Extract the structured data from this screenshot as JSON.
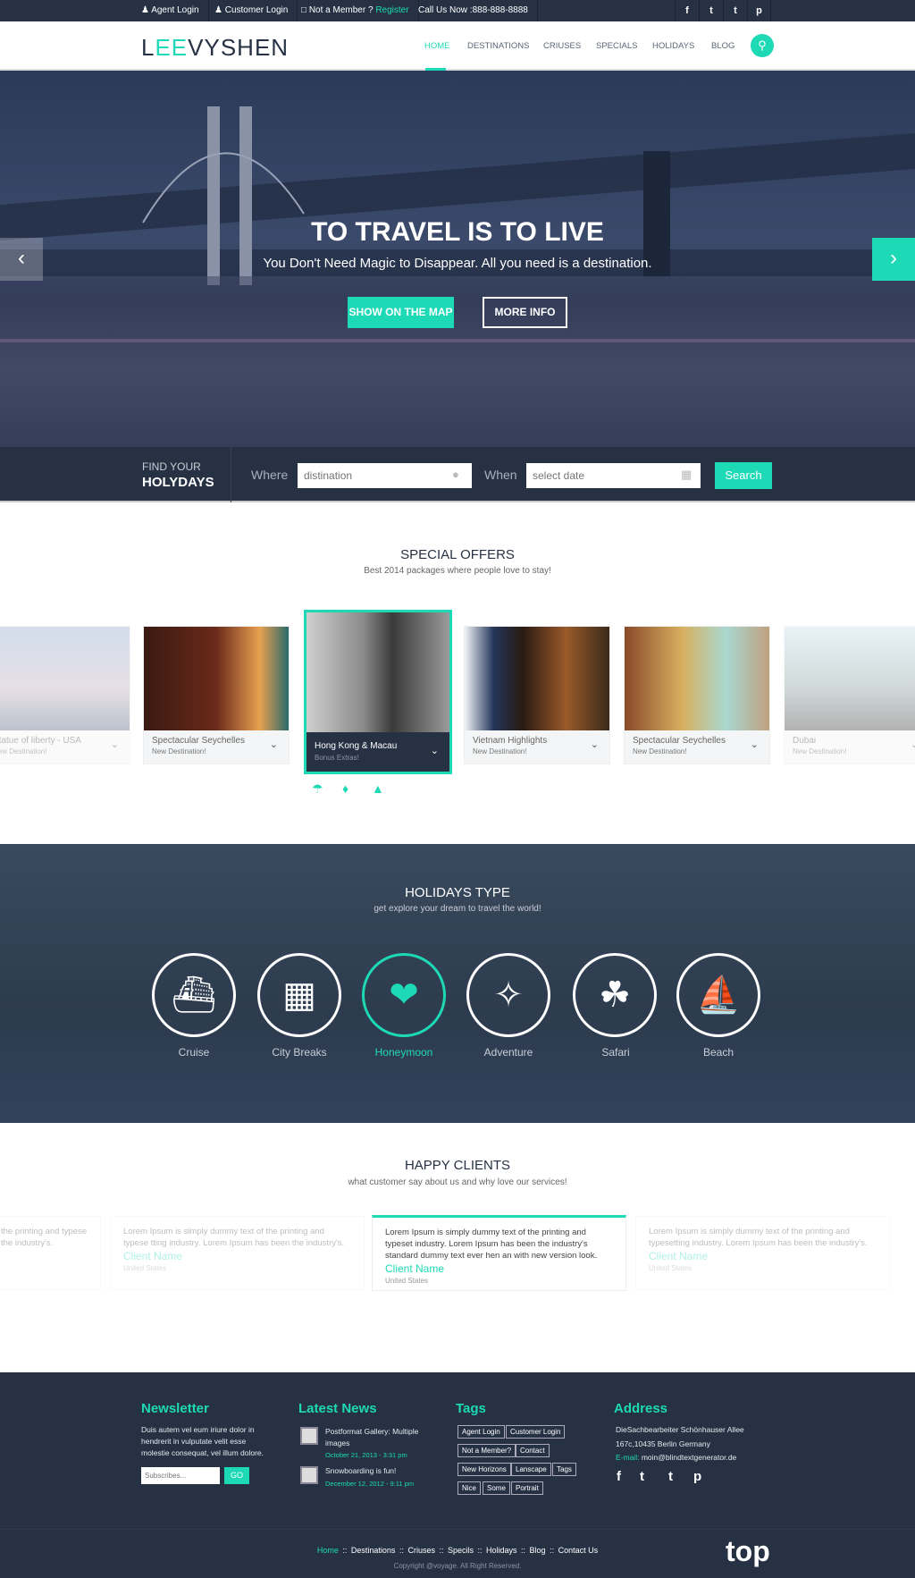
{
  "topbar": {
    "agent_login": "Agent Login",
    "customer_login": "Customer Login",
    "not_member": "Not a Member ?",
    "register": "Register",
    "call": "Call Us Now :888-888-8888",
    "social": [
      "f",
      "t",
      "t",
      "p"
    ]
  },
  "header": {
    "logo_a": "L",
    "logo_b": "EE",
    "logo_c": "VYSHEN",
    "nav": [
      "HOME",
      "DESTINATIONS",
      "CRIUSES",
      "SPECIALS",
      "HOLIDAYS",
      "BLOG"
    ]
  },
  "hero": {
    "title": "TO TRAVEL IS TO LIVE",
    "subtitle": "You Don't Need Magic to Disappear. All you need is a destination.",
    "show_map": "SHOW ON THE MAP",
    "more_info": "MORE INFO"
  },
  "search": {
    "find_your": "FIND YOUR",
    "holydays": "HOLYDAYS",
    "where": "Where",
    "where_placeholder": "distination",
    "when": "When",
    "when_placeholder": "select date",
    "button": "Search"
  },
  "offers": {
    "title": "SPECIAL OFFERS",
    "subtitle": "Best 2014 packages where people love to stay!",
    "cards": [
      {
        "title": "Statue of liberty - USA",
        "sub": "New Destination!"
      },
      {
        "title": "Spectacular Seychelles",
        "sub": "New Destination!"
      },
      {
        "title": "Hong Kong & Macau",
        "sub": "Bonus Extras!"
      },
      {
        "title": "Vietnam Highlights",
        "sub": "New Destination!"
      },
      {
        "title": "Spectacular Seychelles",
        "sub": "New Destination!"
      },
      {
        "title": "Dubai",
        "sub": "New Destination!"
      }
    ]
  },
  "holidays": {
    "title": "HOLIDAYS TYPE",
    "subtitle": "get explore your dream to travel the world!",
    "types": [
      "Cruise",
      "City Breaks",
      "Honeymoon",
      "Adventure",
      "Safari",
      "Beach"
    ]
  },
  "clients": {
    "title": "HAPPY CLIENTS",
    "subtitle": "what customer say about us and why love our services!",
    "cards": [
      {
        "text": "the printing and typese the industry's."
      },
      {
        "text": "Lorem Ipsum is simply dummy text of the printing and typese tting industry. Lorem Ipsum has been the industry's.",
        "name": "Client Name",
        "country": "United States"
      },
      {
        "text": "Lorem Ipsum is simply dummy text of the printing and typeset industry. Lorem Ipsum has been the industry's standard dummy text ever hen an with new version look.",
        "name": "Client Name",
        "country": "United States"
      },
      {
        "text": "Lorem Ipsum is simply dummy text of the printing and typesetting industry. Lorem Ipsum has been the industry's.",
        "name": "Client Name",
        "country": "United States"
      }
    ]
  },
  "footer": {
    "newsletter": {
      "title": "Newsletter",
      "text": "Duis autem vel eum iriure dolor in hendrerit in vulputate velit esse molestie consequat, vel illum dolore.",
      "placeholder": "Subscribes...",
      "go": "GO"
    },
    "news": {
      "title": "Latest News",
      "items": [
        {
          "title": "Postformat Gallery: Multiple images",
          "date": "October 21, 2013 - 3:31 pm"
        },
        {
          "title": "Snowboarding is fun!",
          "date": "December 12, 2012 - 9:11 pm"
        }
      ]
    },
    "tags": {
      "title": "Tags",
      "items": [
        "Agent Login",
        "Customer Login",
        "Not a Member?",
        "Contact",
        "New Horizons",
        "Lanscape",
        "Tags",
        "Nice",
        "Some",
        "Portrait"
      ]
    },
    "address": {
      "title": "Address",
      "line1": "DieSachbearbeiter Schönhauser Allee",
      "line2": "167c,10435 Berlin Germany",
      "email_label": "E-mail:",
      "email": "moin@blindtextgenerator.de",
      "social": [
        "f",
        "t",
        "t",
        "p"
      ]
    }
  },
  "bottom": {
    "links": [
      "Home",
      "Destinations",
      "Criuses",
      "Specils",
      "Holidays",
      "Blog",
      "Contact Us"
    ],
    "copyright": "Copyright @voyage. All Right Reserved.",
    "top_logo": "top"
  },
  "colors": {
    "accent": "#1dd9b5",
    "dark": "#263244"
  }
}
